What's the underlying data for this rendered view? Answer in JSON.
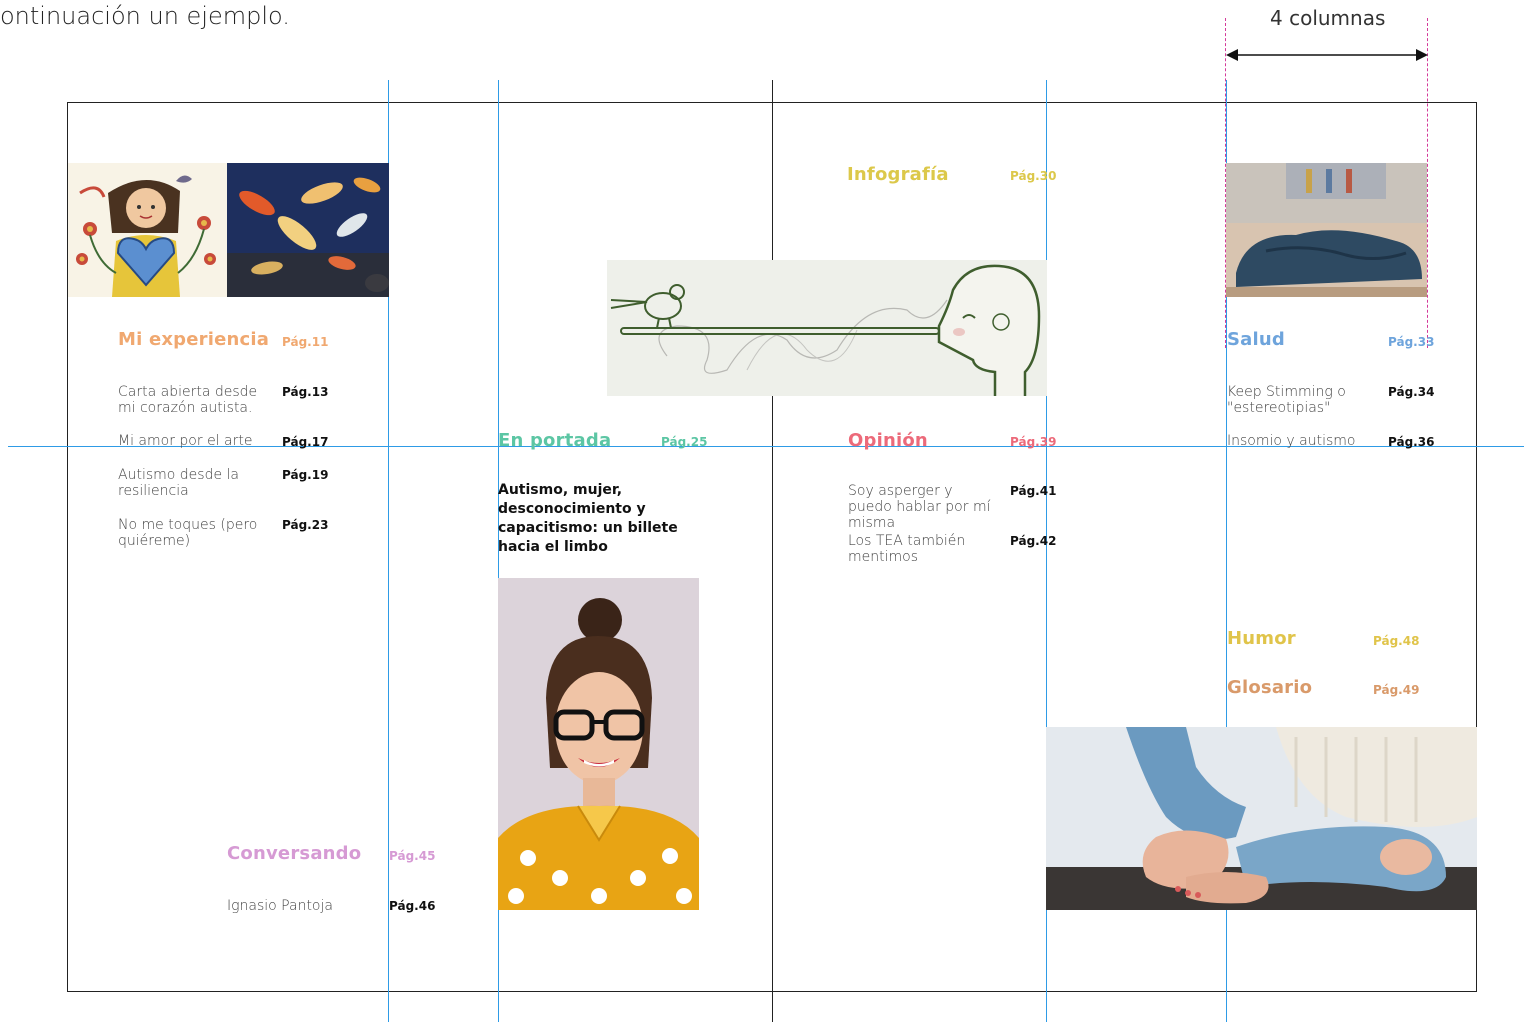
{
  "intro_text": "ontinuación un ejemplo.",
  "columns_label": "4 columnas",
  "colors": {
    "mi_experiencia": "#f0a870",
    "conversando": "#d69ad4",
    "en_portada": "#5cc6a4",
    "infografia": "#dcc84a",
    "opinion": "#ec6a7a",
    "salud": "#6ea4dc",
    "humor": "#e0c44a",
    "glosario": "#d99a6a",
    "guides": "#2e9be6",
    "margin_guide": "#d43a9a"
  },
  "sections": {
    "mi_experiencia": {
      "title": "Mi experiencia",
      "page": "Pág.11",
      "items": [
        {
          "text": "Carta abierta desde mi corazón autista.",
          "page": "Pág.13"
        },
        {
          "text": "Mi amor por el arte",
          "page": "Pág.17"
        },
        {
          "text": "Autismo desde la resiliencia",
          "page": "Pág.19"
        },
        {
          "text": "No me toques (pero quiéreme)",
          "page": "Pág.23"
        }
      ]
    },
    "conversando": {
      "title": "Conversando",
      "page": "Pág.45",
      "items": [
        {
          "text": "Ignasio Pantoja",
          "page": "Pág.46"
        }
      ]
    },
    "en_portada": {
      "title": "En portada",
      "page": "Pág.25",
      "feature": "Autismo, mujer, desconocimiento y capacitismo: un billete hacia el limbo"
    },
    "infografia": {
      "title": "Infografía",
      "page": "Pág.30"
    },
    "opinion": {
      "title": "Opinión",
      "page": "Pág.39",
      "items": [
        {
          "text": "Soy asperger y puedo hablar por mí misma",
          "page": "Pág.41"
        },
        {
          "text": "Los TEA también mentimos",
          "page": "Pág.42"
        }
      ]
    },
    "salud": {
      "title": "Salud",
      "page": "Pág.33",
      "items": [
        {
          "text": "Keep Stimming o \"estereotipias\"",
          "page": "Pág.34"
        },
        {
          "text": "Insomio y autismo",
          "page": "Pág.36"
        }
      ]
    },
    "humor": {
      "title": "Humor",
      "page": "Pág.48"
    },
    "glosario": {
      "title": "Glosario",
      "page": "Pág.49"
    }
  },
  "images": {
    "girl_heart": "girl-with-heart-illustration",
    "koi_fish": "koi-fish-painting",
    "pinocchio": "long-nose-bird-illustration",
    "woman_portrait": "smiling-woman-glasses-photo",
    "person_sleeping": "person-under-blanket-photo",
    "feet": "crossed-legs-feet-photo"
  }
}
